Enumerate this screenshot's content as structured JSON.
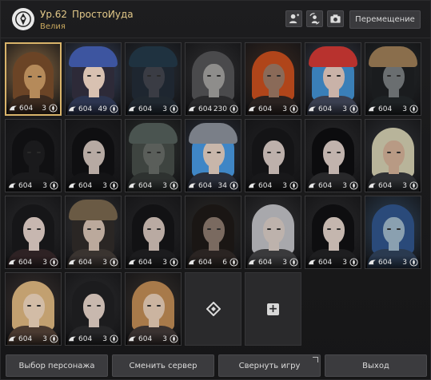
{
  "header": {
    "level": "Ур.62",
    "family_name": "ПростоИуда",
    "server": "Велия",
    "move_label": "Перемещение",
    "icons": [
      "emblem-icon",
      "add-friend-icon",
      "swap-icon",
      "camera-icon"
    ]
  },
  "characters": [
    {
      "a": "604",
      "b": "3",
      "selected": true,
      "tone": "#b58a5a",
      "hair": "#6b4426",
      "outfit": "#3b2a1f",
      "bg": "#8a6a44"
    },
    {
      "a": "604",
      "b": "49",
      "tone": "#d8c1b1",
      "hair": "#2d2a38",
      "outfit": "#2c3550",
      "bg": "#3d4a66",
      "hat": "#3d55a0"
    },
    {
      "a": "604",
      "b": "3",
      "tone": "#3a3c44",
      "hair": "#1e2630",
      "outfit": "#202830",
      "bg": "#2a3038",
      "hat": "#1f3240"
    },
    {
      "a": "604",
      "b": "230",
      "tone": "#8e8d8b",
      "hair": "#4a4a4c",
      "outfit": "#2a2a2c",
      "bg": "#2f2f31"
    },
    {
      "a": "604",
      "b": "3",
      "tone": "#8a6a58",
      "hair": "#b0451a",
      "outfit": "#2a2220",
      "bg": "#3a2a22"
    },
    {
      "a": "604",
      "b": "3",
      "tone": "#c9b2a8",
      "hair": "#3a7fb8",
      "outfit": "#3a3f50",
      "bg": "#3a3f4c",
      "hat": "#b8322e"
    },
    {
      "a": "604",
      "b": "3",
      "tone": "#6a6e70",
      "hair": "#1a1c1e",
      "outfit": "#1e2224",
      "bg": "#262a2c",
      "hat": "#8a6e4c"
    },
    {
      "a": "604",
      "b": "3",
      "tone": "#1a1a1c",
      "hair": "#101012",
      "outfit": "#1a1a1c",
      "bg": "#202022"
    },
    {
      "a": "604",
      "b": "3",
      "tone": "#b7aaa3",
      "hair": "#0f0f11",
      "outfit": "#141416",
      "bg": "#202022"
    },
    {
      "a": "604",
      "b": "3",
      "tone": "#5a5e5a",
      "hair": "#3e4440",
      "outfit": "#2e3230",
      "bg": "#303432",
      "hat": "#4a5450"
    },
    {
      "a": "604",
      "b": "34",
      "tone": "#c8b6aa",
      "hair": "#3f86c6",
      "outfit": "#2a2e3a",
      "bg": "#2e3440",
      "hat": "#7a7f88"
    },
    {
      "a": "604",
      "b": "3",
      "tone": "#bdb0ab",
      "hair": "#141416",
      "outfit": "#18181a",
      "bg": "#222224"
    },
    {
      "a": "604",
      "b": "3",
      "tone": "#c1b3ad",
      "hair": "#0c0c0e",
      "outfit": "#28282a",
      "bg": "#2a2a2c"
    },
    {
      "a": "604",
      "b": "3",
      "tone": "#b89a84",
      "hair": "#b8b49a",
      "outfit": "#2e3034",
      "bg": "#303236"
    },
    {
      "a": "604",
      "b": "3",
      "tone": "#c7b7b0",
      "hair": "#161618",
      "outfit": "#2e2224",
      "bg": "#2a2a2c"
    },
    {
      "a": "604",
      "b": "3",
      "tone": "#bba99c",
      "hair": "#2a2624",
      "outfit": "#3a3430",
      "bg": "#343436",
      "hat": "#6a5a44"
    },
    {
      "a": "604",
      "b": "3",
      "tone": "#b9aaa2",
      "hair": "#121214",
      "outfit": "#1c1c1e",
      "bg": "#262628"
    },
    {
      "a": "604",
      "b": "6",
      "tone": "#7a6a60",
      "hair": "#1a1614",
      "outfit": "#2a2422",
      "bg": "#2c2a28"
    },
    {
      "a": "604",
      "b": "3",
      "tone": "#bdb2ac",
      "hair": "#a8a8ac",
      "outfit": "#3a3a3c",
      "bg": "#323234"
    },
    {
      "a": "604",
      "b": "3",
      "tone": "#c4b6ae",
      "hair": "#0e0e10",
      "outfit": "#1e1e20",
      "bg": "#2a2a2c"
    },
    {
      "a": "604",
      "b": "3",
      "tone": "#8aa0b0",
      "hair": "#2a4a7a",
      "outfit": "#2a3a50",
      "bg": "#2e4258"
    },
    {
      "a": "604",
      "b": "3",
      "tone": "#d2bca6",
      "hair": "#c2a070",
      "outfit": "#4a3a30",
      "bg": "#3a3230"
    },
    {
      "a": "604",
      "b": "3",
      "tone": "#c8b8ae",
      "hair": "#1c1c1e",
      "outfit": "#262628",
      "bg": "#2c2c2e"
    },
    {
      "a": "604",
      "b": "3",
      "tone": "#cbb4a0",
      "hair": "#a87a4a",
      "outfit": "#3a3230",
      "bg": "#36302c"
    }
  ],
  "footer": {
    "select_label": "Выбор персонажа",
    "server_label": "Сменить сервер",
    "minimize_label": "Свернуть игру",
    "exit_label": "Выход"
  }
}
